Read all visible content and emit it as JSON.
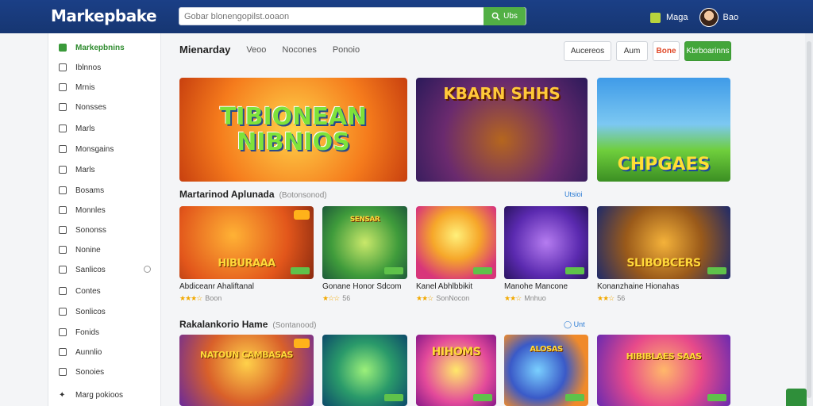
{
  "app": {
    "logo": "Markepbake"
  },
  "search": {
    "placeholder": "Gobar blonengopilst.ooaon",
    "button_label": "Ubs"
  },
  "topbar": {
    "user_label": "Maga",
    "account_label": "Bao"
  },
  "sidebar": {
    "items": [
      {
        "label": "Markepbnins",
        "icon": "home-icon",
        "active": true
      },
      {
        "label": "Iblnnos",
        "icon": "folder-icon"
      },
      {
        "label": "Mrnis",
        "icon": "list-icon"
      },
      {
        "label": "Nonsses",
        "icon": "grid-icon"
      },
      {
        "label": "Marls",
        "icon": "bookmark-icon"
      },
      {
        "label": "Monsgains",
        "icon": "chart-icon"
      },
      {
        "label": "Marls",
        "icon": "mail-icon"
      },
      {
        "label": "Bosams",
        "icon": "book-icon"
      },
      {
        "label": "Monnles",
        "icon": "user-icon"
      },
      {
        "label": "Sononss",
        "icon": "list-icon"
      },
      {
        "label": "Nonine",
        "icon": "edit-icon"
      },
      {
        "label": "Sanlicos",
        "icon": "box-icon"
      },
      {
        "label": "Contes",
        "icon": "globe-icon"
      },
      {
        "label": "Sonlicos",
        "icon": "settings-icon"
      },
      {
        "label": "Fonids",
        "icon": "clock-icon"
      },
      {
        "label": "Aunnlio",
        "icon": "search-icon"
      },
      {
        "label": "Sonoies",
        "icon": "list-icon"
      },
      {
        "label": "Marg pokioos",
        "icon": "plus-icon"
      }
    ]
  },
  "tabs": [
    {
      "label": "Mienarday",
      "active": true
    },
    {
      "label": "Veoo"
    },
    {
      "label": "Nocones"
    },
    {
      "label": "Ponoio"
    }
  ],
  "header_buttons": [
    "Aucereos",
    "Aum",
    "Bone",
    "Kbrboarinns"
  ],
  "banners": [
    {
      "text": "TIBIONEAN NIBNIOS"
    },
    {
      "text": "KBARN SHHS"
    },
    {
      "text": "CHPGAES"
    }
  ],
  "section1": {
    "title": "Martarinod Aplunada",
    "subtitle": "(Botonsonod)",
    "link": "Utsioi",
    "games": [
      {
        "art": "HIBURAAA",
        "name": "Abdiceanr Ahaliftanal",
        "rating": "Boon"
      },
      {
        "art": "SENSAR",
        "name": "Gonane Honor Sdcom",
        "rating": "56"
      },
      {
        "art": "",
        "name": "Kanel Abhlbbikit",
        "rating": "SonNocon"
      },
      {
        "art": "",
        "name": "Manohe Mancone",
        "rating": "Mnhuo"
      },
      {
        "art": "SLIBOBCERS",
        "name": "Konanzhaine Hionahas",
        "rating": "56"
      }
    ]
  },
  "section2": {
    "title": "Rakalankorio Hame",
    "subtitle": "(Sontanood)",
    "link": "Unt",
    "games": [
      {
        "art": "NATOUN CAMBASAS"
      },
      {
        "art": ""
      },
      {
        "art": "HIHOMS"
      },
      {
        "art": "ALOSAS"
      },
      {
        "art": "HIBIBLAES SAAS"
      }
    ]
  },
  "colors": {
    "topbar": "#1b3f86",
    "accent_green": "#43a63a",
    "link_blue": "#2a7bd4",
    "star": "#f2a900"
  }
}
